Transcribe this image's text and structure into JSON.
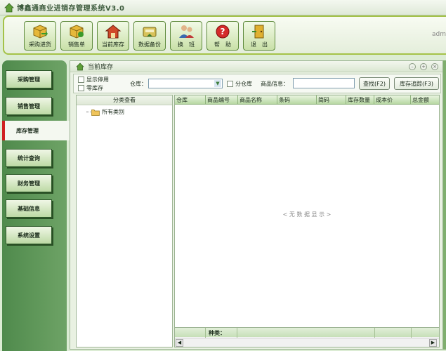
{
  "app": {
    "title": "博鑫通商业进销存管理系统V3.0",
    "user": "adm"
  },
  "toolbar": {
    "buttons": [
      {
        "label": "采购进货",
        "icon": "purchase-icon"
      },
      {
        "label": "销售单",
        "icon": "sales-icon"
      },
      {
        "label": "当前库存",
        "icon": "inventory-icon"
      },
      {
        "label": "数据备份",
        "icon": "backup-icon"
      },
      {
        "label": "换　班",
        "icon": "shift-change-icon"
      },
      {
        "label": "帮　助",
        "icon": "help-icon"
      },
      {
        "label": "退　出",
        "icon": "exit-icon"
      }
    ]
  },
  "nav": {
    "items": [
      {
        "label": "采购管理"
      },
      {
        "label": "销售管理"
      },
      {
        "label": "库存管理",
        "active": true
      },
      {
        "label": "统计查询"
      },
      {
        "label": "财务管理"
      },
      {
        "label": "基础信息"
      },
      {
        "label": "系统设置"
      }
    ]
  },
  "panel": {
    "title": "当前库存",
    "filters": {
      "show_disabled": "显示停用",
      "zero_stock": "零库存",
      "warehouse_label": "仓库：",
      "warehouse_value": "",
      "sub_warehouse": "分仓库",
      "product_info_label": "商品信息：",
      "product_info_value": "",
      "search_button": "查找(F2)",
      "trace_button": "库存追踪(F3)"
    },
    "tree": {
      "header": "分类查看",
      "root": "所有类别"
    },
    "grid": {
      "columns": [
        "仓库",
        "商品编号",
        "商品名称",
        "条码",
        "简码",
        "库存数量",
        "成本价",
        "总金额"
      ],
      "empty_message": "< 无 数 据 显 示 >",
      "footer_label": "种类："
    }
  },
  "colors": {
    "accent": "#a4c248",
    "nav_bg": "#5d9658",
    "active_marker": "#d02020"
  }
}
